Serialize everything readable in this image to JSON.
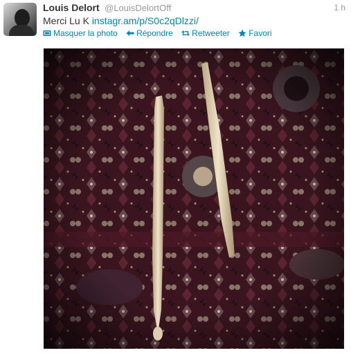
{
  "tweet": {
    "author_name": "Louis Delort",
    "author_handle": "@LouisDelortOff",
    "time": "1 h",
    "text_prefix": "Merci Lu K ",
    "link_text": "instagr.am/p/S0c2qDlzzi/"
  },
  "actions": {
    "hide_photo": "Masquer la photo",
    "reply": "Répondre",
    "retweet": "Retweeter",
    "favorite": "Favori"
  },
  "colors": {
    "link": "#0084b4",
    "muted": "#999999",
    "text": "#333333"
  },
  "icons": [
    "photo-icon",
    "reply-icon",
    "retweet-icon",
    "star-icon"
  ]
}
